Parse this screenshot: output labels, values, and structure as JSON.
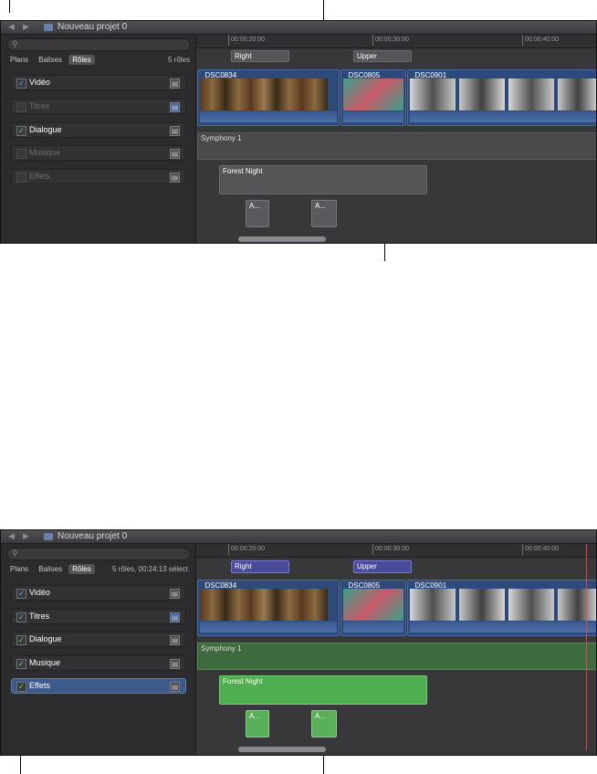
{
  "app": {
    "project_title": "Nouveau projet 0"
  },
  "sidebar": {
    "search_placeholder": "",
    "tabs": [
      "Plans",
      "Balises",
      "Rôles"
    ],
    "roles": [
      {
        "label": "Vidéo",
        "on_top": true,
        "on_bottom": true
      },
      {
        "label": "Titres",
        "on_top": false,
        "on_bottom": true
      },
      {
        "label": "Dialogue",
        "on_top": true,
        "on_bottom": true
      },
      {
        "label": "Musique",
        "on_top": false,
        "on_bottom": true
      },
      {
        "label": "Effets",
        "on_top": false,
        "on_bottom": true
      }
    ],
    "count_top": "5 rôles",
    "count_bottom": "5 rôles, 00:24:13 sélect."
  },
  "timeline": {
    "ruler": [
      "00:00:20:00",
      "00:00:30:00",
      "00:00:40:00"
    ],
    "titles": [
      "Right",
      "Upper"
    ],
    "video_clips": [
      "_DSC0834",
      "_DSC0805",
      "_DSC0901"
    ],
    "music_clip": "Symphony 1",
    "effects_clip": "Forest Night",
    "small_clips": [
      "A...",
      "A..."
    ]
  },
  "colors": {
    "accent": "#3d5a8a",
    "selected_audio": "#4fae4f",
    "playhead": "#e04848"
  }
}
